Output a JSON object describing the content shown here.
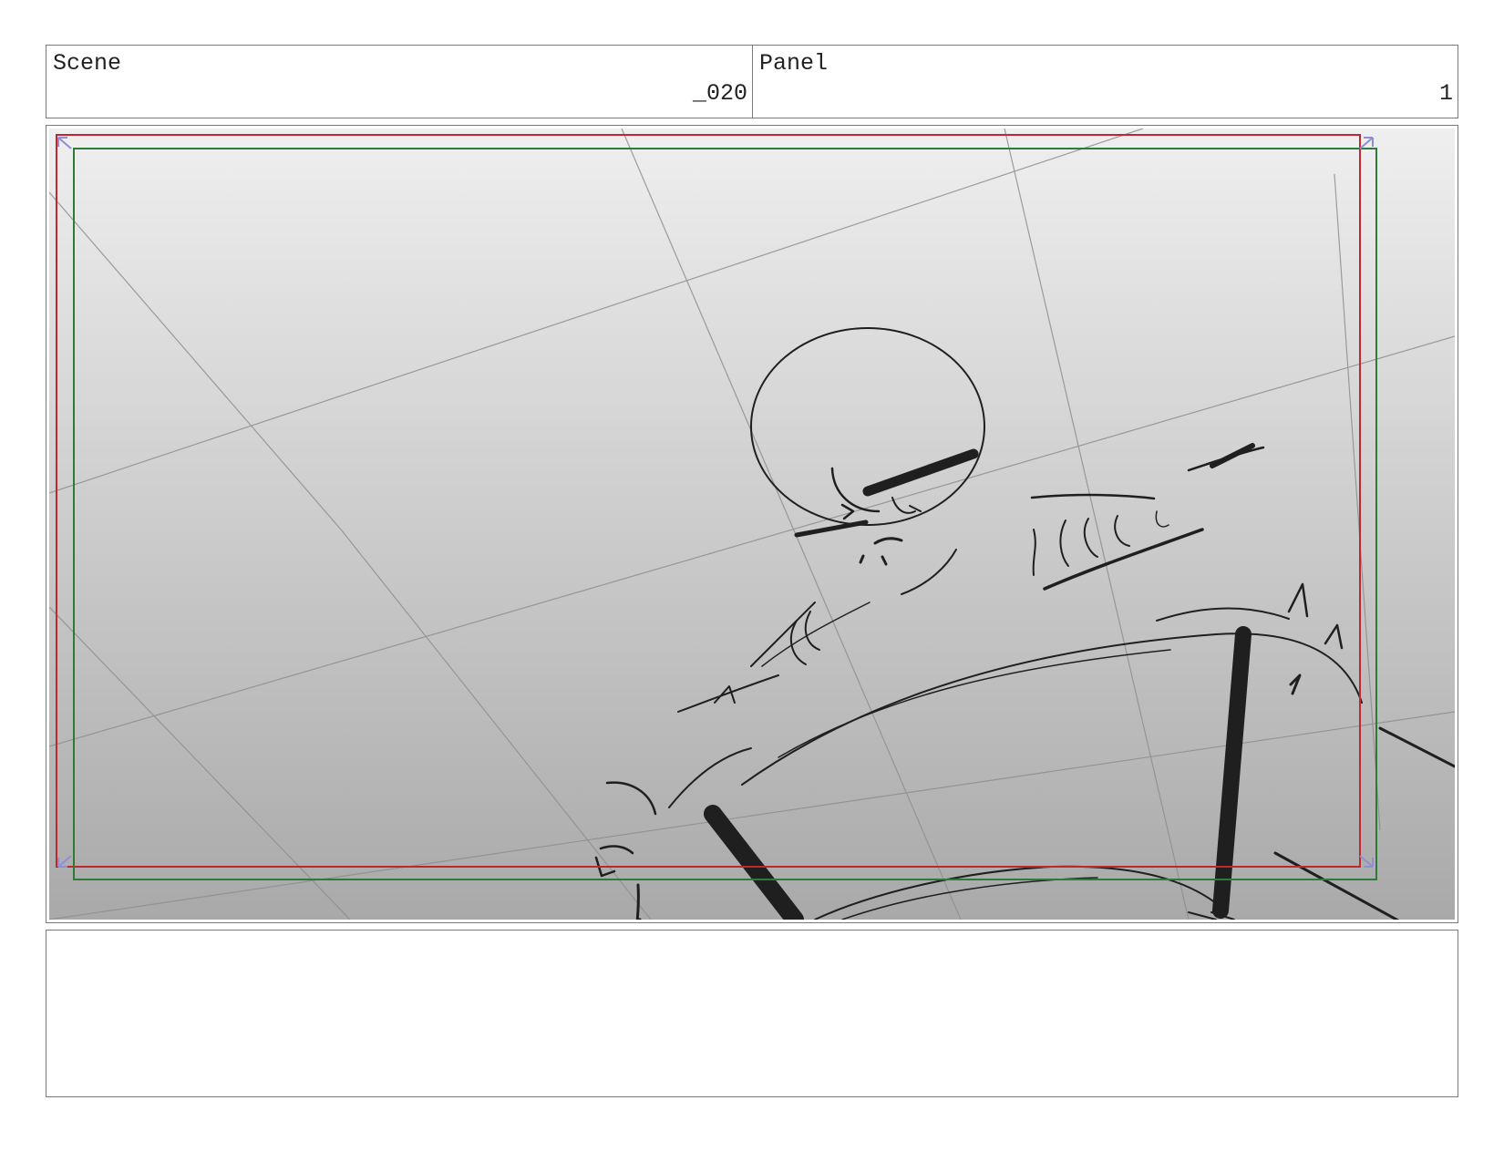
{
  "header": {
    "scene_label": "Scene",
    "scene_value": "_020",
    "panel_label": "Panel",
    "panel_value": "1"
  },
  "frame": {
    "safe_frame_color": "#c0282f",
    "camera_frame_color": "#2f7a36",
    "corner_marker_color": "#8f8fd6",
    "background_top_color": "#efeff0",
    "background_bottom_color": "#a9a9a9"
  },
  "notes": {
    "text": ""
  }
}
